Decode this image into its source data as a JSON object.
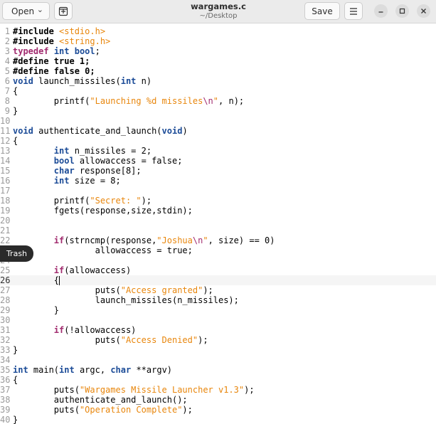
{
  "header": {
    "open_label": "Open",
    "save_label": "Save",
    "title": "wargames.c",
    "subtitle": "~/Desktop"
  },
  "tooltip": {
    "text": "Trash"
  },
  "editor": {
    "current_line": 26,
    "lines": [
      {
        "n": "1",
        "tokens": [
          {
            "t": "#include ",
            "c": "pp"
          },
          {
            "t": "<stdio.h>",
            "c": "inc"
          }
        ]
      },
      {
        "n": "2",
        "tokens": [
          {
            "t": "#include ",
            "c": "pp"
          },
          {
            "t": "<string.h>",
            "c": "inc"
          }
        ]
      },
      {
        "n": "3",
        "tokens": [
          {
            "t": "typedef",
            "c": "kw"
          },
          {
            "t": " "
          },
          {
            "t": "int",
            "c": "ty"
          },
          {
            "t": " "
          },
          {
            "t": "bool",
            "c": "ty"
          },
          {
            "t": ";"
          }
        ]
      },
      {
        "n": "4",
        "tokens": [
          {
            "t": "#define true 1;",
            "c": "pp"
          }
        ]
      },
      {
        "n": "5",
        "tokens": [
          {
            "t": "#define false 0;",
            "c": "pp"
          }
        ]
      },
      {
        "n": "6",
        "tokens": [
          {
            "t": "void",
            "c": "ty"
          },
          {
            "t": " launch_missiles("
          },
          {
            "t": "int",
            "c": "ty"
          },
          {
            "t": " n)"
          }
        ]
      },
      {
        "n": "7",
        "tokens": [
          {
            "t": "{"
          }
        ]
      },
      {
        "n": "8",
        "tokens": [
          {
            "t": "        printf("
          },
          {
            "t": "\"Launching %d missiles",
            "c": "str"
          },
          {
            "t": "\\n",
            "c": "esc"
          },
          {
            "t": "\"",
            "c": "str"
          },
          {
            "t": ", n);"
          }
        ]
      },
      {
        "n": "9",
        "tokens": [
          {
            "t": "}"
          }
        ]
      },
      {
        "n": "10",
        "tokens": []
      },
      {
        "n": "11",
        "tokens": [
          {
            "t": "void",
            "c": "ty"
          },
          {
            "t": " authenticate_and_launch("
          },
          {
            "t": "void",
            "c": "ty"
          },
          {
            "t": ")"
          }
        ]
      },
      {
        "n": "12",
        "tokens": [
          {
            "t": "{"
          }
        ]
      },
      {
        "n": "13",
        "tokens": [
          {
            "t": "        "
          },
          {
            "t": "int",
            "c": "ty"
          },
          {
            "t": " n_missiles = 2;"
          }
        ]
      },
      {
        "n": "14",
        "tokens": [
          {
            "t": "        "
          },
          {
            "t": "bool",
            "c": "ty"
          },
          {
            "t": " allowaccess = false;"
          }
        ]
      },
      {
        "n": "15",
        "tokens": [
          {
            "t": "        "
          },
          {
            "t": "char",
            "c": "ty"
          },
          {
            "t": " response[8];"
          }
        ]
      },
      {
        "n": "16",
        "tokens": [
          {
            "t": "        "
          },
          {
            "t": "int",
            "c": "ty"
          },
          {
            "t": " size = 8;"
          }
        ]
      },
      {
        "n": "17",
        "tokens": []
      },
      {
        "n": "18",
        "tokens": [
          {
            "t": "        printf("
          },
          {
            "t": "\"Secret: \"",
            "c": "str"
          },
          {
            "t": ");"
          }
        ]
      },
      {
        "n": "19",
        "tokens": [
          {
            "t": "        fgets(response,size,stdin);"
          }
        ]
      },
      {
        "n": "20",
        "tokens": []
      },
      {
        "n": "21",
        "tokens": []
      },
      {
        "n": "22",
        "tokens": [
          {
            "t": "        "
          },
          {
            "t": "if",
            "c": "kw"
          },
          {
            "t": "(strncmp(response,"
          },
          {
            "t": "\"Joshua",
            "c": "str"
          },
          {
            "t": "\\n",
            "c": "esc"
          },
          {
            "t": "\"",
            "c": "str"
          },
          {
            "t": ", size) == 0)"
          }
        ]
      },
      {
        "n": "23",
        "tokens": [
          {
            "t": "                allowaccess = true;"
          }
        ]
      },
      {
        "n": "24",
        "tokens": []
      },
      {
        "n": "25",
        "tokens": [
          {
            "t": "        "
          },
          {
            "t": "if",
            "c": "kw"
          },
          {
            "t": "(allowaccess)"
          }
        ]
      },
      {
        "n": "26",
        "tokens": [
          {
            "t": "        {"
          }
        ]
      },
      {
        "n": "27",
        "tokens": [
          {
            "t": "                puts("
          },
          {
            "t": "\"Access granted\"",
            "c": "str"
          },
          {
            "t": ");"
          }
        ]
      },
      {
        "n": "28",
        "tokens": [
          {
            "t": "                launch_missiles(n_missiles);"
          }
        ]
      },
      {
        "n": "29",
        "tokens": [
          {
            "t": "        }"
          }
        ]
      },
      {
        "n": "30",
        "tokens": []
      },
      {
        "n": "31",
        "tokens": [
          {
            "t": "        "
          },
          {
            "t": "if",
            "c": "kw"
          },
          {
            "t": "(!allowaccess)"
          }
        ]
      },
      {
        "n": "32",
        "tokens": [
          {
            "t": "                puts("
          },
          {
            "t": "\"Access Denied\"",
            "c": "str"
          },
          {
            "t": ");"
          }
        ]
      },
      {
        "n": "33",
        "tokens": [
          {
            "t": "}"
          }
        ]
      },
      {
        "n": "34",
        "tokens": []
      },
      {
        "n": "35",
        "tokens": [
          {
            "t": "int",
            "c": "ty"
          },
          {
            "t": " main("
          },
          {
            "t": "int",
            "c": "ty"
          },
          {
            "t": " argc, "
          },
          {
            "t": "char",
            "c": "ty"
          },
          {
            "t": " **argv)"
          }
        ]
      },
      {
        "n": "36",
        "tokens": [
          {
            "t": "{"
          }
        ]
      },
      {
        "n": "37",
        "tokens": [
          {
            "t": "        puts("
          },
          {
            "t": "\"Wargames Missile Launcher v1.3\"",
            "c": "str"
          },
          {
            "t": ");"
          }
        ]
      },
      {
        "n": "38",
        "tokens": [
          {
            "t": "        authenticate_and_launch();"
          }
        ]
      },
      {
        "n": "39",
        "tokens": [
          {
            "t": "        puts("
          },
          {
            "t": "\"Operation Complete\"",
            "c": "str"
          },
          {
            "t": ");"
          }
        ]
      },
      {
        "n": "40",
        "tokens": [
          {
            "t": "}"
          }
        ]
      }
    ]
  }
}
